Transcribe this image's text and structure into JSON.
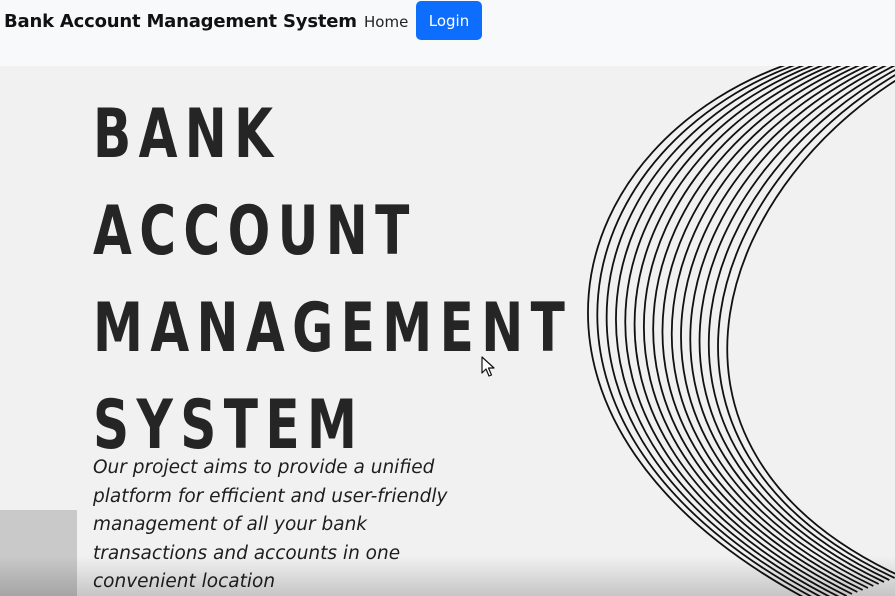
{
  "navbar": {
    "brand": "Bank Account Management System",
    "home_label": "Home",
    "login_label": "Login"
  },
  "hero": {
    "title_lines": [
      "BANK",
      "ACCOUNT",
      "MANAGEMENT",
      "SYSTEM"
    ],
    "description": "Our project aims to provide a unified platform for efficient and user-friendly management of all your bank transactions and accounts in one convenient location"
  },
  "colors": {
    "login_button": "#0d6efd",
    "hero_background": "#f1f1f1",
    "title_text": "#252525"
  },
  "icons": {
    "decoration": "wave-lines-graphic",
    "pointer": "mouse-cursor-icon"
  }
}
